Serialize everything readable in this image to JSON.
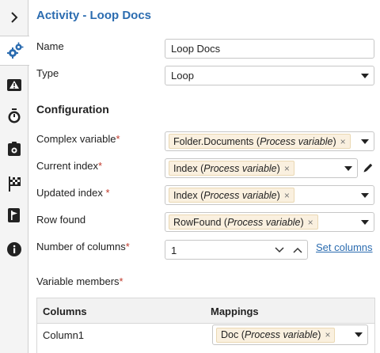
{
  "header": {
    "title": "Activity  - Loop Docs"
  },
  "rail": {
    "items": [
      {
        "icon": "chevron-right-icon"
      },
      {
        "icon": "gears-icon"
      },
      {
        "icon": "warning-icon"
      },
      {
        "icon": "stopwatch-icon"
      },
      {
        "icon": "clipboard-camera-icon"
      },
      {
        "icon": "checkered-flag-icon"
      },
      {
        "icon": "flag-icon"
      },
      {
        "icon": "info-icon"
      }
    ]
  },
  "form": {
    "name_label": "Name",
    "name_value": "Loop Docs",
    "type_label": "Type",
    "type_value": "Loop"
  },
  "config": {
    "section_title": "Configuration",
    "complex_label": "Complex variable",
    "complex_chip_name": "Folder.Documents",
    "complex_chip_kind": "Process variable",
    "current_label": "Current index",
    "current_chip_name": "Index",
    "current_chip_kind": "Process variable",
    "updated_label": "Updated index ",
    "updated_chip_name": "Index",
    "updated_chip_kind": "Process variable",
    "row_label": "Row found",
    "row_chip_name": "RowFound",
    "row_chip_kind": "Process variable",
    "columns_label": "Number of columns",
    "columns_value": "1",
    "set_columns": "Set columns",
    "members_label": "Variable members",
    "required_mark": "*",
    "remove_glyph": "×"
  },
  "table": {
    "headers": [
      "Columns",
      "Mappings"
    ],
    "rows": [
      {
        "column": "Column1",
        "chip_name": "Doc",
        "chip_kind": "Process variable"
      }
    ]
  },
  "colors": {
    "accent": "#2b6cb0",
    "required": "#c0392b",
    "chip_bg": "#faf0df"
  }
}
